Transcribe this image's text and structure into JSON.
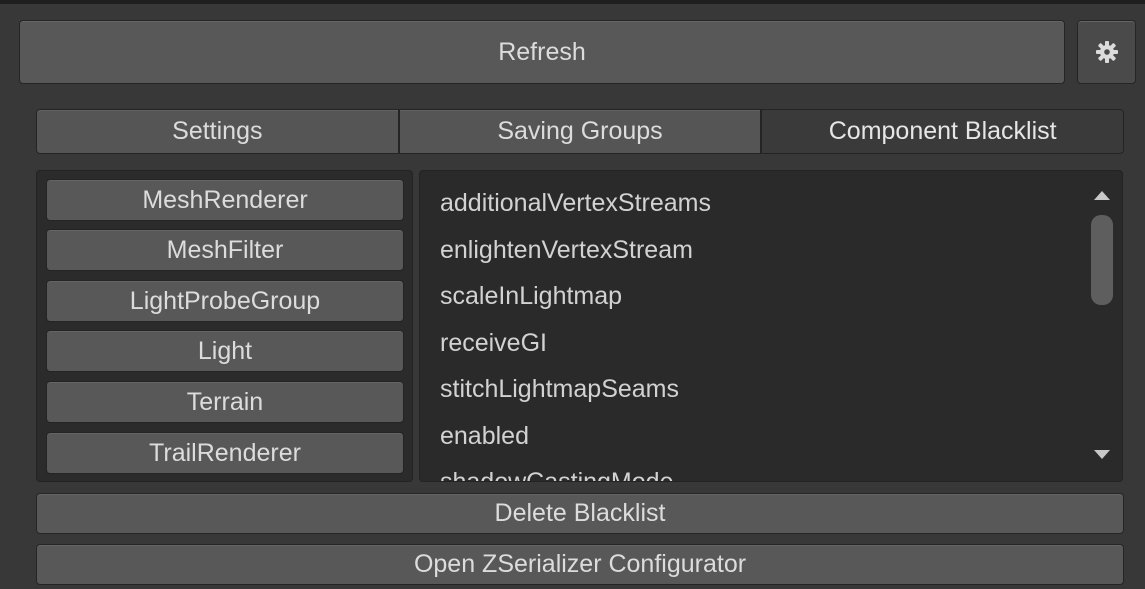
{
  "refresh_label": "Refresh",
  "tabs": [
    {
      "label": "Settings"
    },
    {
      "label": "Saving Groups"
    },
    {
      "label": "Component Blacklist"
    }
  ],
  "active_tab": "Component Blacklist",
  "components": [
    "MeshRenderer",
    "MeshFilter",
    "LightProbeGroup",
    "Light",
    "Terrain",
    "TrailRenderer"
  ],
  "fields": [
    "additionalVertexStreams",
    "enlightenVertexStream",
    "scaleInLightmap",
    "receiveGI",
    "stitchLightmapSeams",
    "enabled",
    "shadowCastingMode"
  ],
  "delete_blacklist_label": "Delete Blacklist",
  "open_configurator_label": "Open ZSerializer Configurator",
  "icons": {
    "settings": "gear-icon",
    "scroll_up": "triangle-up-icon",
    "scroll_down": "triangle-down-icon"
  },
  "colors": {
    "background": "#383838",
    "button": "#585858",
    "active_tab": "#3a3a3a",
    "text": "#dcdcdc"
  }
}
